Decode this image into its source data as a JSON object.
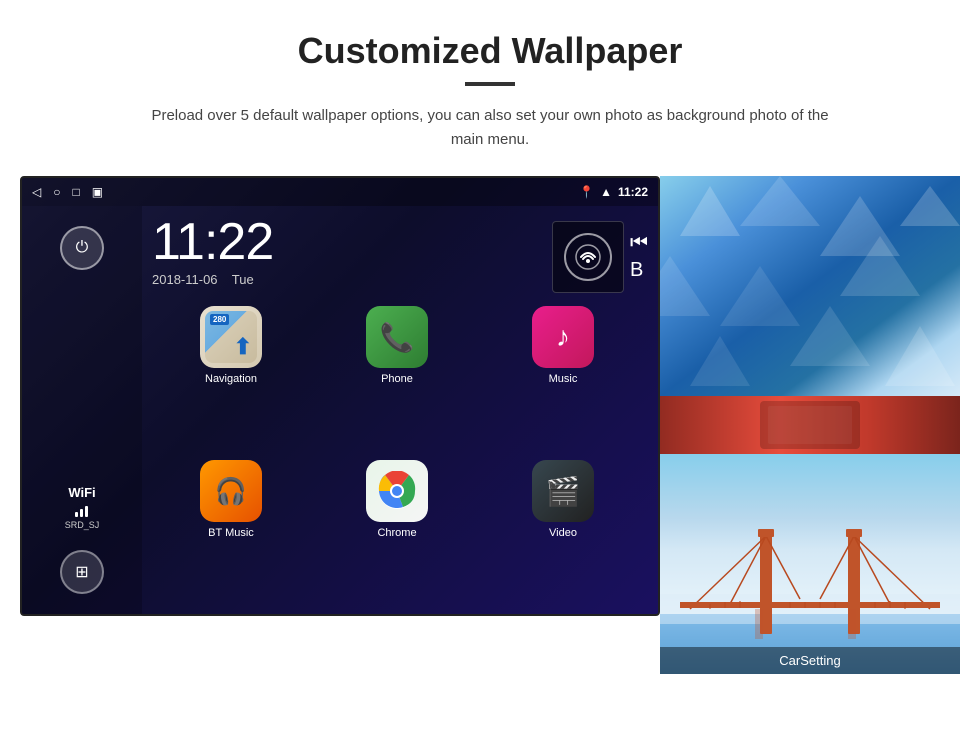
{
  "page": {
    "title": "Customized Wallpaper",
    "subtitle": "Preload over 5 default wallpaper options, you can also set your own photo as background photo of the main menu."
  },
  "statusBar": {
    "time": "11:22",
    "leftIcons": [
      "back-icon",
      "home-icon",
      "square-icon",
      "screenshot-icon"
    ],
    "rightIcons": [
      "location-icon",
      "wifi-icon",
      "time-icon"
    ]
  },
  "clockWidget": {
    "time": "11:22",
    "date": "2018-11-06",
    "day": "Tue"
  },
  "sidebar": {
    "powerLabel": "⏻",
    "wifiLabel": "WiFi",
    "wifiSignal": "▂▄▆",
    "wifiSsid": "SRD_SJ",
    "gridLabel": "⊞"
  },
  "apps": [
    {
      "name": "Navigation",
      "type": "nav",
      "badge": "280",
      "label": "Navigation"
    },
    {
      "name": "Phone",
      "type": "phone",
      "label": "Phone"
    },
    {
      "name": "Music",
      "type": "music",
      "label": "Music"
    },
    {
      "name": "BT Music",
      "type": "bt",
      "label": "BT Music"
    },
    {
      "name": "Chrome",
      "type": "chrome",
      "label": "Chrome"
    },
    {
      "name": "Video",
      "type": "video",
      "label": "Video"
    }
  ],
  "wallpapers": [
    {
      "name": "ice-wallpaper",
      "type": "ice"
    },
    {
      "name": "red-wallpaper",
      "type": "small-red"
    },
    {
      "name": "bridge-wallpaper",
      "type": "bridge",
      "carSettingLabel": "CarSetting"
    }
  ]
}
